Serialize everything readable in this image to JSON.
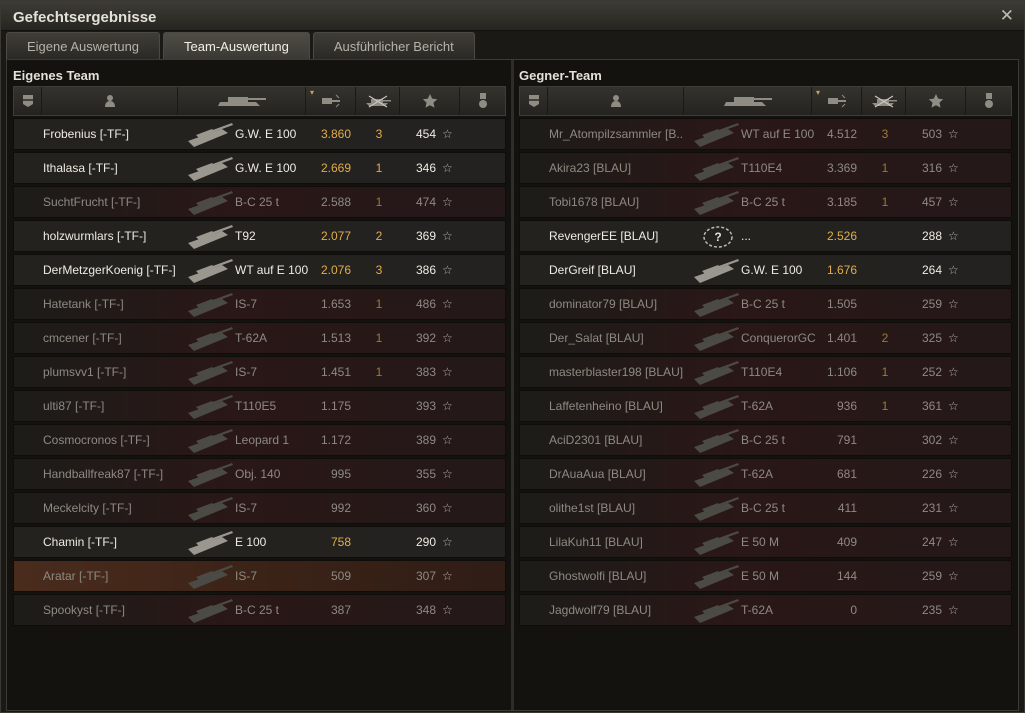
{
  "window": {
    "title": "Gefechtsergebnisse",
    "close_icon": "close-icon"
  },
  "tabs": [
    {
      "label": "Eigene Auswertung",
      "active": false
    },
    {
      "label": "Team-Auswertung",
      "active": true
    },
    {
      "label": "Ausführlicher Bericht",
      "active": false
    }
  ],
  "columns": {
    "icons": [
      "squad-icon",
      "player-icon",
      "tank-icon",
      "damage-icon",
      "kills-icon",
      "points-star-icon",
      "medal-icon"
    ],
    "sort_column": "damage",
    "sort_indicator": "▾"
  },
  "own_team": {
    "title": "Eigenes Team",
    "players": [
      {
        "name": "Frobenius [-TF-]",
        "tank": "G.W. E 100",
        "xp": "3.860",
        "kills": "3",
        "points": "454",
        "alive": true,
        "self": false
      },
      {
        "name": "Ithalasa [-TF-]",
        "tank": "G.W. E 100",
        "xp": "2.669",
        "kills": "1",
        "points": "346",
        "alive": true,
        "self": false
      },
      {
        "name": "SuchtFrucht [-TF-]",
        "tank": "B-C 25 t",
        "xp": "2.588",
        "kills": "1",
        "points": "474",
        "alive": false,
        "self": false
      },
      {
        "name": "holzwurmlars [-TF-]",
        "tank": "T92",
        "xp": "2.077",
        "kills": "2",
        "points": "369",
        "alive": true,
        "self": false
      },
      {
        "name": "DerMetzgerKoenig [-TF-]",
        "tank": "WT auf E 100",
        "xp": "2.076",
        "kills": "3",
        "points": "386",
        "alive": true,
        "self": false
      },
      {
        "name": "Hatetank [-TF-]",
        "tank": "IS-7",
        "xp": "1.653",
        "kills": "1",
        "points": "486",
        "alive": false,
        "self": false
      },
      {
        "name": "cmcener [-TF-]",
        "tank": "T-62A",
        "xp": "1.513",
        "kills": "1",
        "points": "392",
        "alive": false,
        "self": false
      },
      {
        "name": "plumsvv1 [-TF-]",
        "tank": "IS-7",
        "xp": "1.451",
        "kills": "1",
        "points": "383",
        "alive": false,
        "self": false
      },
      {
        "name": "ulti87 [-TF-]",
        "tank": "T110E5",
        "xp": "1.175",
        "kills": "",
        "points": "393",
        "alive": false,
        "self": false
      },
      {
        "name": "Cosmocronos [-TF-]",
        "tank": "Leopard 1",
        "xp": "1.172",
        "kills": "",
        "points": "389",
        "alive": false,
        "self": false
      },
      {
        "name": "Handballfreak87 [-TF-]",
        "tank": "Obj. 140",
        "xp": "995",
        "kills": "",
        "points": "355",
        "alive": false,
        "self": false
      },
      {
        "name": "Meckelcity [-TF-]",
        "tank": "IS-7",
        "xp": "992",
        "kills": "",
        "points": "360",
        "alive": false,
        "self": false
      },
      {
        "name": "Chamin [-TF-]",
        "tank": "E 100",
        "xp": "758",
        "kills": "",
        "points": "290",
        "alive": true,
        "self": false
      },
      {
        "name": "Aratar [-TF-]",
        "tank": "IS-7",
        "xp": "509",
        "kills": "",
        "points": "307",
        "alive": false,
        "self": true
      },
      {
        "name": "Spookyst [-TF-]",
        "tank": "B-C 25 t",
        "xp": "387",
        "kills": "",
        "points": "348",
        "alive": false,
        "self": false
      }
    ]
  },
  "enemy_team": {
    "title": "Gegner-Team",
    "players": [
      {
        "name": "Mr_Atompilzsammler [B..",
        "tank": "WT auf E 100",
        "xp": "4.512",
        "kills": "3",
        "points": "503",
        "alive": false,
        "self": false
      },
      {
        "name": "Akira23 [BLAU]",
        "tank": "T110E4",
        "xp": "3.369",
        "kills": "1",
        "points": "316",
        "alive": false,
        "self": false
      },
      {
        "name": "Tobi1678 [BLAU]",
        "tank": "B-C 25 t",
        "xp": "3.185",
        "kills": "1",
        "points": "457",
        "alive": false,
        "self": false
      },
      {
        "name": "RevengerEE [BLAU]",
        "tank": "...",
        "xp": "2.526",
        "kills": "",
        "points": "288",
        "alive": true,
        "self": false,
        "unknown": true
      },
      {
        "name": "DerGreif [BLAU]",
        "tank": "G.W. E 100",
        "xp": "1.676",
        "kills": "",
        "points": "264",
        "alive": true,
        "self": false
      },
      {
        "name": "dominator79 [BLAU]",
        "tank": "B-C 25 t",
        "xp": "1.505",
        "kills": "",
        "points": "259",
        "alive": false,
        "self": false
      },
      {
        "name": "Der_Salat [BLAU]",
        "tank": "ConquerorGC",
        "xp": "1.401",
        "kills": "2",
        "points": "325",
        "alive": false,
        "self": false
      },
      {
        "name": "masterblaster198 [BLAU]",
        "tank": "T110E4",
        "xp": "1.106",
        "kills": "1",
        "points": "252",
        "alive": false,
        "self": false
      },
      {
        "name": "Laffetenheino [BLAU]",
        "tank": "T-62A",
        "xp": "936",
        "kills": "1",
        "points": "361",
        "alive": false,
        "self": false
      },
      {
        "name": "AciD2301 [BLAU]",
        "tank": "B-C 25 t",
        "xp": "791",
        "kills": "",
        "points": "302",
        "alive": false,
        "self": false
      },
      {
        "name": "DrAuaAua [BLAU]",
        "tank": "T-62A",
        "xp": "681",
        "kills": "",
        "points": "226",
        "alive": false,
        "self": false
      },
      {
        "name": "olithe1st [BLAU]",
        "tank": "B-C 25 t",
        "xp": "411",
        "kills": "",
        "points": "231",
        "alive": false,
        "self": false
      },
      {
        "name": "LilaKuh11 [BLAU]",
        "tank": "E 50 M",
        "xp": "409",
        "kills": "",
        "points": "247",
        "alive": false,
        "self": false
      },
      {
        "name": "Ghostwolfi [BLAU]",
        "tank": "E 50 M",
        "xp": "144",
        "kills": "",
        "points": "259",
        "alive": false,
        "self": false
      },
      {
        "name": "Jagdwolf79 [BLAU]",
        "tank": "T-62A",
        "xp": "0",
        "kills": "",
        "points": "235",
        "alive": false,
        "self": false
      }
    ]
  },
  "colors": {
    "alive_xp": "#e1ad4a",
    "dead_row": "#2a1717",
    "self_row": "#4a2c1d"
  }
}
